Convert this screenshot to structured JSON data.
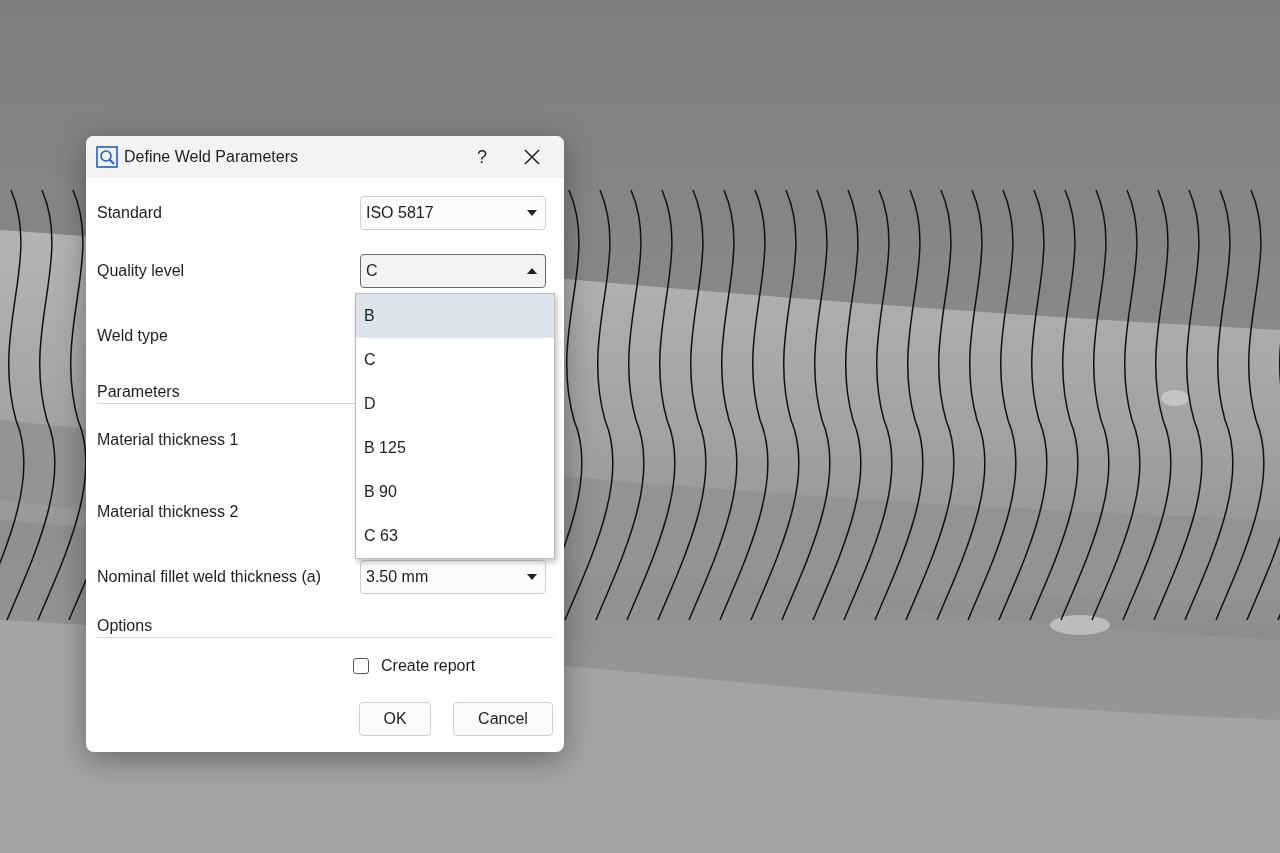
{
  "window": {
    "title": "Define Weld Parameters",
    "help": "?"
  },
  "rows": [
    {
      "kind": "combo",
      "label": "Standard",
      "value": "ISO 5817",
      "open": false
    },
    {
      "kind": "combo",
      "label": "Quality level",
      "value": "C",
      "open": true
    },
    {
      "kind": "covered",
      "label": "Weld type"
    },
    {
      "kind": "section",
      "label": "Parameters"
    },
    {
      "kind": "covered",
      "label": "Material thickness 1"
    },
    {
      "kind": "covered",
      "label": "Material thickness 2"
    },
    {
      "kind": "combo",
      "label": "Nominal fillet weld thickness (a)",
      "value": "3.50 mm",
      "open": false
    },
    {
      "kind": "section",
      "label": "Options"
    },
    {
      "kind": "checkbox",
      "label": "Create report",
      "checked": false
    }
  ],
  "dropdown": {
    "options": [
      {
        "label": "B",
        "selected": true
      },
      {
        "label": "C",
        "selected": false
      },
      {
        "label": "D",
        "selected": false
      },
      {
        "label": "B 125",
        "selected": false
      },
      {
        "label": "B 90",
        "selected": false
      },
      {
        "label": "C 63",
        "selected": false
      }
    ]
  },
  "buttons": [
    "OK",
    "Cancel"
  ]
}
